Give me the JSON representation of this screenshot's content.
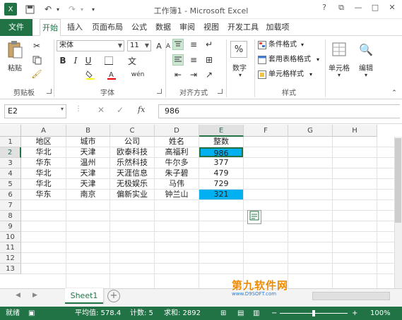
{
  "window": {
    "title": "工作簿1 - Microsoft Excel",
    "buttons": [
      "?",
      "⧉",
      "—",
      "□",
      "✕"
    ]
  },
  "ribbon_tabs": [
    "文件",
    "开始",
    "插入",
    "页面布局",
    "公式",
    "数据",
    "审阅",
    "视图",
    "开发工具",
    "加载项"
  ],
  "active_tab": "开始",
  "ribbon": {
    "clipboard": {
      "paste": "粘贴",
      "group": "剪贴板"
    },
    "font": {
      "name": "宋体",
      "size": "11",
      "group": "字体"
    },
    "alignment": {
      "group": "对齐方式"
    },
    "number": {
      "label": "数字",
      "symbol": "%"
    },
    "styles": {
      "conditional": "条件格式",
      "table_format": "套用表格格式",
      "cell_styles": "单元格样式",
      "group": "样式"
    },
    "cells": {
      "label": "单元格"
    },
    "editing": {
      "label": "编辑"
    }
  },
  "formula_bar": {
    "name_box": "E2",
    "fx": "fx",
    "value": "986"
  },
  "columns": [
    "A",
    "B",
    "C",
    "D",
    "E",
    "F",
    "G",
    "H"
  ],
  "rows": [
    "1",
    "2",
    "3",
    "4",
    "5",
    "6",
    "7",
    "8",
    "9",
    "10",
    "11",
    "12",
    "13"
  ],
  "table": {
    "header": [
      "地区",
      "城市",
      "公司",
      "姓名",
      "整数"
    ],
    "body": [
      [
        "华北",
        "天津",
        "欧泰科技",
        "高福利",
        "986"
      ],
      [
        "华东",
        "温州",
        "乐然科技",
        "牛尔多",
        "377"
      ],
      [
        "华北",
        "天津",
        "天涯信息",
        "朱子碧",
        "479"
      ],
      [
        "华北",
        "天津",
        "无极娱乐",
        "马伟",
        "729"
      ],
      [
        "华东",
        "南京",
        "偏新实业",
        "钟兰山",
        "321"
      ]
    ]
  },
  "highlight_color": "#00b0f0",
  "accent_color": "#217346",
  "sheet_tabs": [
    "Sheet1"
  ],
  "status_bar": {
    "mode": "就绪",
    "average": "平均值: 578.4",
    "count": "计数: 5",
    "sum": "求和: 2892",
    "zoom": "100%"
  },
  "watermark": {
    "main": "第九软件网",
    "sub": "www.D9SOFT.com"
  }
}
